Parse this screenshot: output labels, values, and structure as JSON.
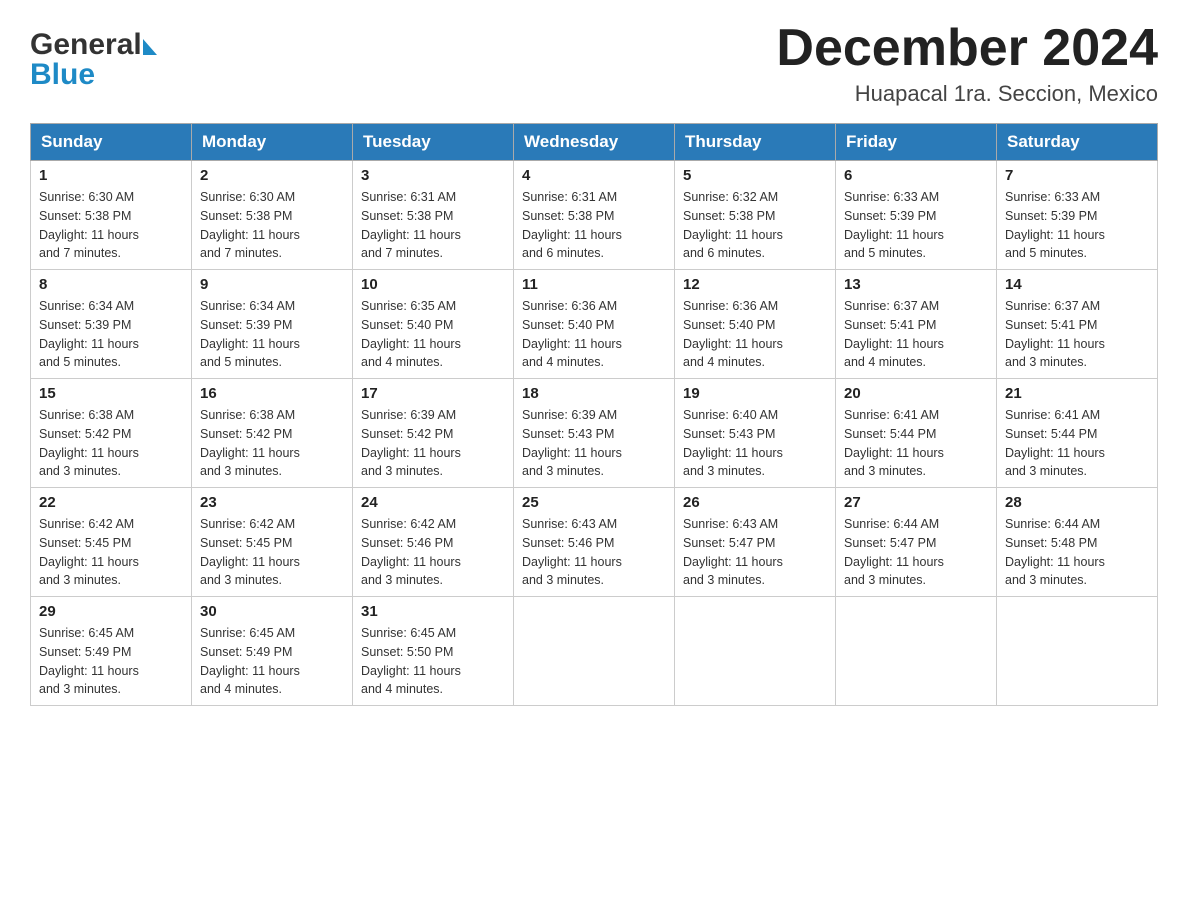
{
  "header": {
    "logo_general": "General",
    "logo_blue": "Blue",
    "month_title": "December 2024",
    "location": "Huapacal 1ra. Seccion, Mexico"
  },
  "weekdays": [
    "Sunday",
    "Monday",
    "Tuesday",
    "Wednesday",
    "Thursday",
    "Friday",
    "Saturday"
  ],
  "weeks": [
    [
      {
        "day": "1",
        "sunrise": "6:30 AM",
        "sunset": "5:38 PM",
        "daylight": "11 hours and 7 minutes."
      },
      {
        "day": "2",
        "sunrise": "6:30 AM",
        "sunset": "5:38 PM",
        "daylight": "11 hours and 7 minutes."
      },
      {
        "day": "3",
        "sunrise": "6:31 AM",
        "sunset": "5:38 PM",
        "daylight": "11 hours and 7 minutes."
      },
      {
        "day": "4",
        "sunrise": "6:31 AM",
        "sunset": "5:38 PM",
        "daylight": "11 hours and 6 minutes."
      },
      {
        "day": "5",
        "sunrise": "6:32 AM",
        "sunset": "5:38 PM",
        "daylight": "11 hours and 6 minutes."
      },
      {
        "day": "6",
        "sunrise": "6:33 AM",
        "sunset": "5:39 PM",
        "daylight": "11 hours and 5 minutes."
      },
      {
        "day": "7",
        "sunrise": "6:33 AM",
        "sunset": "5:39 PM",
        "daylight": "11 hours and 5 minutes."
      }
    ],
    [
      {
        "day": "8",
        "sunrise": "6:34 AM",
        "sunset": "5:39 PM",
        "daylight": "11 hours and 5 minutes."
      },
      {
        "day": "9",
        "sunrise": "6:34 AM",
        "sunset": "5:39 PM",
        "daylight": "11 hours and 5 minutes."
      },
      {
        "day": "10",
        "sunrise": "6:35 AM",
        "sunset": "5:40 PM",
        "daylight": "11 hours and 4 minutes."
      },
      {
        "day": "11",
        "sunrise": "6:36 AM",
        "sunset": "5:40 PM",
        "daylight": "11 hours and 4 minutes."
      },
      {
        "day": "12",
        "sunrise": "6:36 AM",
        "sunset": "5:40 PM",
        "daylight": "11 hours and 4 minutes."
      },
      {
        "day": "13",
        "sunrise": "6:37 AM",
        "sunset": "5:41 PM",
        "daylight": "11 hours and 4 minutes."
      },
      {
        "day": "14",
        "sunrise": "6:37 AM",
        "sunset": "5:41 PM",
        "daylight": "11 hours and 3 minutes."
      }
    ],
    [
      {
        "day": "15",
        "sunrise": "6:38 AM",
        "sunset": "5:42 PM",
        "daylight": "11 hours and 3 minutes."
      },
      {
        "day": "16",
        "sunrise": "6:38 AM",
        "sunset": "5:42 PM",
        "daylight": "11 hours and 3 minutes."
      },
      {
        "day": "17",
        "sunrise": "6:39 AM",
        "sunset": "5:42 PM",
        "daylight": "11 hours and 3 minutes."
      },
      {
        "day": "18",
        "sunrise": "6:39 AM",
        "sunset": "5:43 PM",
        "daylight": "11 hours and 3 minutes."
      },
      {
        "day": "19",
        "sunrise": "6:40 AM",
        "sunset": "5:43 PM",
        "daylight": "11 hours and 3 minutes."
      },
      {
        "day": "20",
        "sunrise": "6:41 AM",
        "sunset": "5:44 PM",
        "daylight": "11 hours and 3 minutes."
      },
      {
        "day": "21",
        "sunrise": "6:41 AM",
        "sunset": "5:44 PM",
        "daylight": "11 hours and 3 minutes."
      }
    ],
    [
      {
        "day": "22",
        "sunrise": "6:42 AM",
        "sunset": "5:45 PM",
        "daylight": "11 hours and 3 minutes."
      },
      {
        "day": "23",
        "sunrise": "6:42 AM",
        "sunset": "5:45 PM",
        "daylight": "11 hours and 3 minutes."
      },
      {
        "day": "24",
        "sunrise": "6:42 AM",
        "sunset": "5:46 PM",
        "daylight": "11 hours and 3 minutes."
      },
      {
        "day": "25",
        "sunrise": "6:43 AM",
        "sunset": "5:46 PM",
        "daylight": "11 hours and 3 minutes."
      },
      {
        "day": "26",
        "sunrise": "6:43 AM",
        "sunset": "5:47 PM",
        "daylight": "11 hours and 3 minutes."
      },
      {
        "day": "27",
        "sunrise": "6:44 AM",
        "sunset": "5:47 PM",
        "daylight": "11 hours and 3 minutes."
      },
      {
        "day": "28",
        "sunrise": "6:44 AM",
        "sunset": "5:48 PM",
        "daylight": "11 hours and 3 minutes."
      }
    ],
    [
      {
        "day": "29",
        "sunrise": "6:45 AM",
        "sunset": "5:49 PM",
        "daylight": "11 hours and 3 minutes."
      },
      {
        "day": "30",
        "sunrise": "6:45 AM",
        "sunset": "5:49 PM",
        "daylight": "11 hours and 4 minutes."
      },
      {
        "day": "31",
        "sunrise": "6:45 AM",
        "sunset": "5:50 PM",
        "daylight": "11 hours and 4 minutes."
      },
      null,
      null,
      null,
      null
    ]
  ],
  "labels": {
    "sunrise": "Sunrise:",
    "sunset": "Sunset:",
    "daylight": "Daylight:"
  }
}
